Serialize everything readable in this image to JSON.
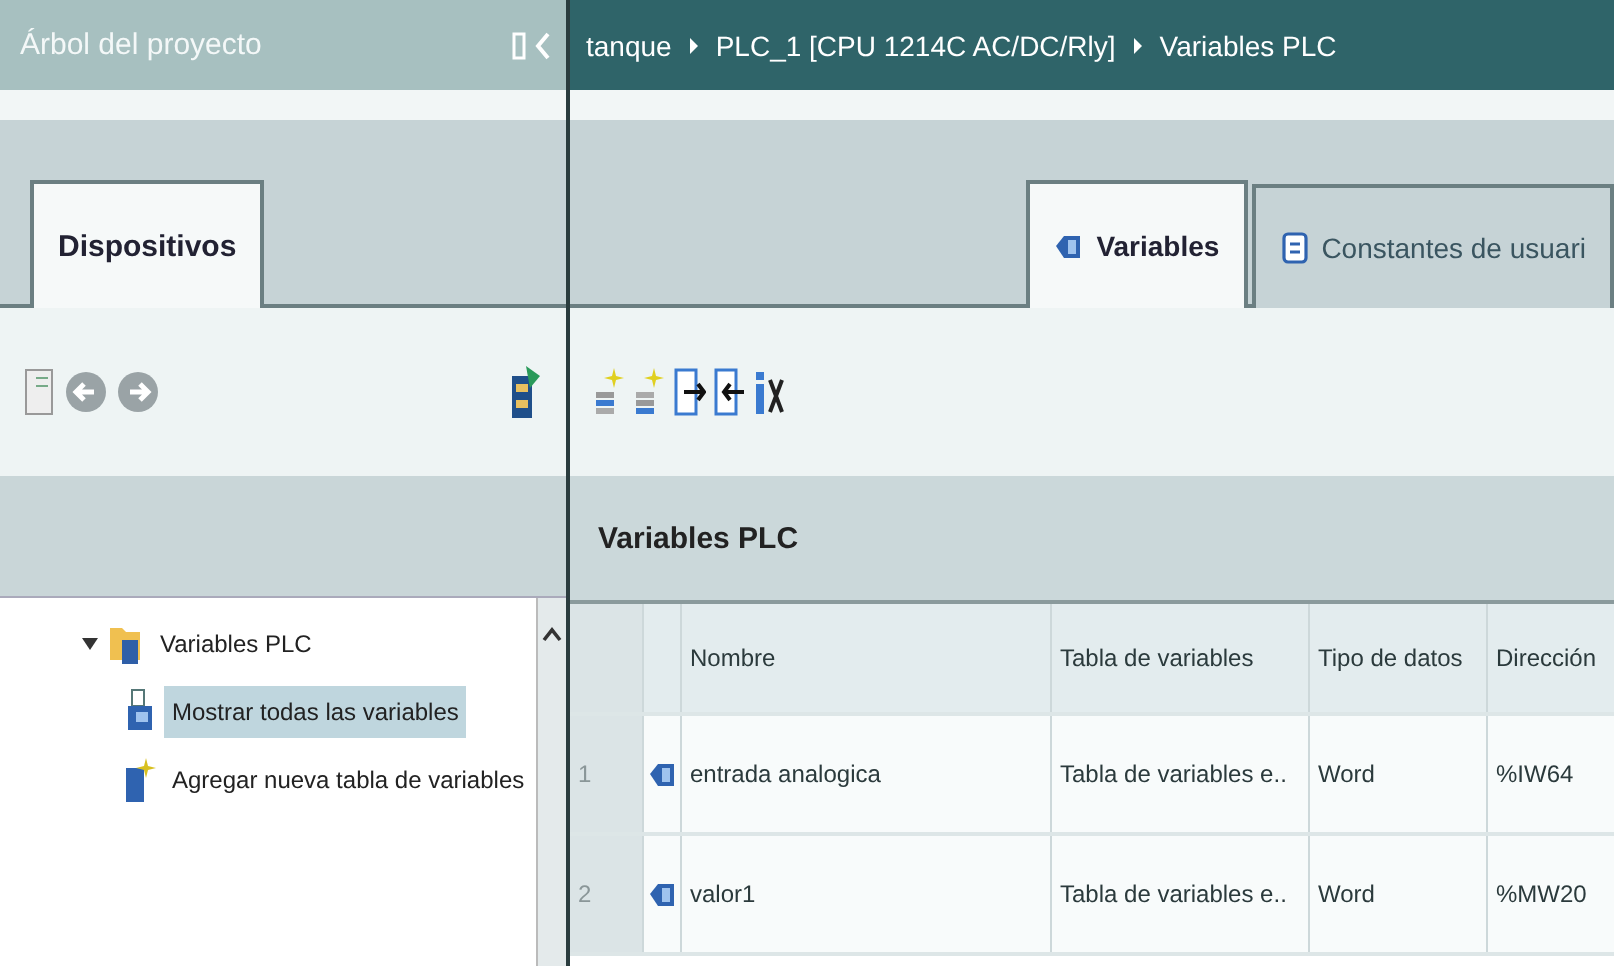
{
  "project_tree": {
    "title": "Árbol del proyecto",
    "tabs": [
      {
        "label": "Dispositivos",
        "selected": true
      }
    ],
    "tree": [
      {
        "label": "Variables PLC",
        "expanded": true,
        "children": [
          {
            "label": "Mostrar todas las variables",
            "kind": "show",
            "selected": true
          },
          {
            "label": "Agregar nueva tabla de variables",
            "kind": "add",
            "selected": false
          }
        ]
      }
    ]
  },
  "editor": {
    "breadcrumb": [
      "tanque",
      "PLC_1 [CPU 1214C AC/DC/Rly]",
      "Variables PLC"
    ],
    "tabs": [
      {
        "label": "Variables",
        "kind": "variables",
        "selected": true
      },
      {
        "label": "Constantes de usuari",
        "kind": "constants",
        "selected": false
      }
    ],
    "section_title": "Variables PLC",
    "table": {
      "columns": [
        "Nombre",
        "Tabla de variables",
        "Tipo de datos",
        "Dirección"
      ],
      "rows": [
        {
          "number": "1",
          "name": "entrada analogica",
          "table": "Tabla de variables e..",
          "data_type": "Word",
          "address": "%IW64"
        },
        {
          "number": "2",
          "name": "valor1",
          "table": "Tabla de variables e..",
          "data_type": "Word",
          "address": "%MW20"
        }
      ]
    }
  }
}
